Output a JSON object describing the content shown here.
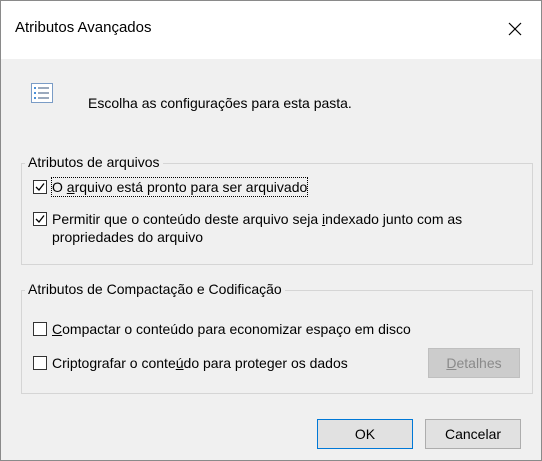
{
  "dialog": {
    "title": "Atributos Avançados",
    "close_icon": "close-icon",
    "header_icon": "folder-properties-icon",
    "header_text": "Escolha as configurações para esta pasta."
  },
  "file_attributes": {
    "legend": "Atributos de arquivos",
    "archive": {
      "label_pre": "O ",
      "label_accel": "a",
      "label_post": "rquivo está pronto para ser arquivado",
      "checked": true
    },
    "index": {
      "label_line1_pre": "Permitir que o conteúdo deste arquivo seja ",
      "label_line1_accel": "i",
      "label_line1_post": "ndexado junto com as",
      "label_line2": "propriedades do arquivo",
      "checked": true
    }
  },
  "compression_encryption": {
    "legend": "Atributos de Compactação e Codificação",
    "compress": {
      "label_accel": "C",
      "label_post": "ompactar o conteúdo para economizar espaço em disco",
      "checked": false
    },
    "encrypt": {
      "label_pre": "Criptografar o conte",
      "label_accel": "ú",
      "label_post": "do para proteger os dados",
      "checked": false
    },
    "details_button": {
      "label_accel": "D",
      "label_post": "etalhes",
      "enabled": false
    }
  },
  "buttons": {
    "ok": "OK",
    "cancel": "Cancelar"
  },
  "colors": {
    "window_bg": "#f0f0f0",
    "titlebar_bg": "#ffffff",
    "accent": "#0078d7"
  }
}
